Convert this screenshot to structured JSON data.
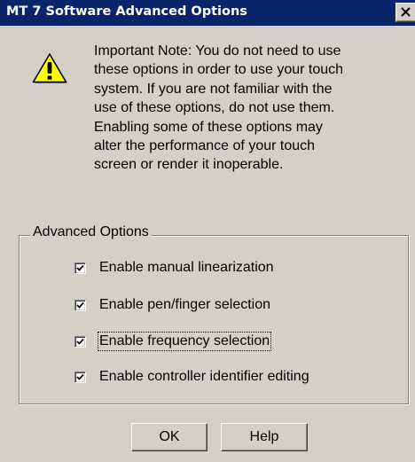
{
  "window": {
    "title": "MT 7 Software Advanced Options",
    "close_glyph": "✕"
  },
  "note": {
    "icon": "warning-icon",
    "text": "Important Note: You do not need to use\nthese options in order to use your touch\nsystem.  If you are not familiar with the\nuse of these options, do not use them.\nEnabling some of these options may\nalter the performance of your touch\nscreen or render it inoperable."
  },
  "advanced": {
    "legend": "Advanced Options",
    "options": [
      {
        "label": "Enable manual linearization",
        "checked": true
      },
      {
        "label": "Enable pen/finger selection",
        "checked": true
      },
      {
        "label": "Enable frequency selection",
        "checked": true,
        "focused": true
      },
      {
        "label": "Enable controller identifier editing",
        "checked": true
      }
    ]
  },
  "buttons": {
    "ok": "OK",
    "help": "Help"
  },
  "colors": {
    "titlebar": "#0a246a",
    "face": "#d4d0c8",
    "warning_yellow": "#ffff00"
  }
}
